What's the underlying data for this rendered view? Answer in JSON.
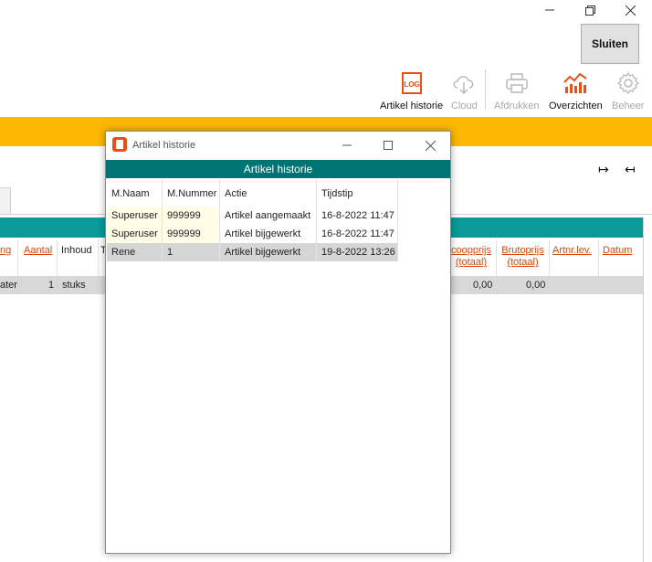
{
  "window": {
    "minimize_glyph": "—",
    "restore_glyph": "❐",
    "close_glyph": "✕"
  },
  "toolbar": {
    "close_label": "Sluiten",
    "items": [
      {
        "label": "Artikel historie",
        "icon": "log-icon",
        "enabled": true
      },
      {
        "label": "Cloud",
        "icon": "cloud-download-icon",
        "enabled": false
      },
      {
        "label": "Afdrukken",
        "icon": "printer-icon",
        "enabled": false
      },
      {
        "label": "Overzichten",
        "icon": "chart-icon",
        "enabled": true
      },
      {
        "label": "Beheer",
        "icon": "gear-icon",
        "enabled": false
      }
    ],
    "log_icon_text": "LOG"
  },
  "arrows": {
    "expand": "↦",
    "collapse": "↤"
  },
  "background_grid": {
    "headers": [
      {
        "text": "ng",
        "link": true
      },
      {
        "text": "Aantal",
        "link": true
      },
      {
        "text": "Inhoud",
        "link": false
      },
      {
        "text": "T",
        "link": false
      },
      {
        "text": "coopprijs (totaal)",
        "link": true
      },
      {
        "text": "Brutoprijs (totaal)",
        "link": true
      },
      {
        "text": "Artnr.lev.",
        "link": true
      },
      {
        "text": "Datum",
        "link": true
      }
    ],
    "row": {
      "c0": "ater",
      "c1": "1",
      "c2": "stuks",
      "c3": "0,00",
      "c4": "0,00"
    }
  },
  "dialog": {
    "title": "Artikel historie",
    "header": "Artikel historie",
    "columns": [
      "M.Naam",
      "M.Nummer",
      "Actie",
      "Tijdstip"
    ],
    "rows": [
      {
        "naam": "Superuser",
        "nummer": "999999",
        "actie": "Artikel aangemaakt",
        "tijdstip": "16-8-2022 11:47",
        "style": "yellow"
      },
      {
        "naam": "Superuser",
        "nummer": "999999",
        "actie": "Artikel bijgewerkt",
        "tijdstip": "16-8-2022 11:47",
        "style": "yellow"
      },
      {
        "naam": "Rene",
        "nummer": "1",
        "actie": "Artikel bijgewerkt",
        "tijdstip": "19-8-2022 13:26",
        "style": "selected"
      }
    ]
  },
  "colors": {
    "accent_orange": "#fbb800",
    "teal_header": "#007373",
    "teal_grid": "#0a9a9a",
    "link_orange": "#d9480f",
    "log_icon": "#e8501b"
  }
}
